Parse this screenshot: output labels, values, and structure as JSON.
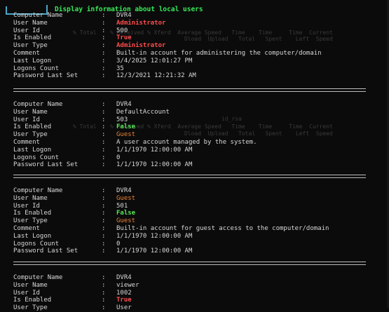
{
  "header": {
    "title": "Display information about local users"
  },
  "labels": {
    "computer_name": "Computer Name",
    "user_name": "User Name",
    "user_id": "User Id",
    "is_enabled": "Is Enabled",
    "user_type": "User Type",
    "comment": "Comment",
    "last_logon": "Last Logon",
    "logons_count": "Logons Count",
    "password_last_set": "Password Last Set",
    "colon": ":"
  },
  "users": [
    {
      "computer_name": "DVR4",
      "user_name": "Administrator",
      "user_id": "500",
      "is_enabled": "True",
      "user_type": "Administrator",
      "comment": "Built-in account for administering the computer/domain",
      "last_logon": "3/4/2025 12:01:27 PM",
      "logons_count": "35",
      "password_last_set": "12/3/2021 12:21:32 AM"
    },
    {
      "computer_name": "DVR4",
      "user_name": "DefaultAccount",
      "user_id": "503",
      "is_enabled": "False",
      "user_type": "Guest",
      "comment": "A user account managed by the system.",
      "last_logon": "1/1/1970 12:00:00 AM",
      "logons_count": "0",
      "password_last_set": "1/1/1970 12:00:00 AM"
    },
    {
      "computer_name": "DVR4",
      "user_name": "Guest",
      "user_id": "501",
      "is_enabled": "False",
      "user_type": "Guest",
      "comment": "Built-in account for guest access to the computer/domain",
      "last_logon": "1/1/1970 12:00:00 AM",
      "logons_count": "0",
      "password_last_set": "1/1/1970 12:00:00 AM"
    },
    {
      "computer_name": "DVR4",
      "user_name": "viewer",
      "user_id": "1002",
      "is_enabled": "True",
      "user_type": "User"
    }
  ],
  "ghost_text": {
    "line1": "% Total    % Received % Xferd  Average Speed   Time    Time     Time  Current",
    "line2": "                                 Dload  Upload   Total   Spent    Left  Speed",
    "line3": "id_rsa"
  },
  "colors": {
    "background": "#0b0b0b",
    "header_accent": "#4aa6c8",
    "header_text": "#38e858",
    "admin_red": "#ff4d4d",
    "guest_orange": "#e8823a",
    "false_green": "#56e856"
  }
}
